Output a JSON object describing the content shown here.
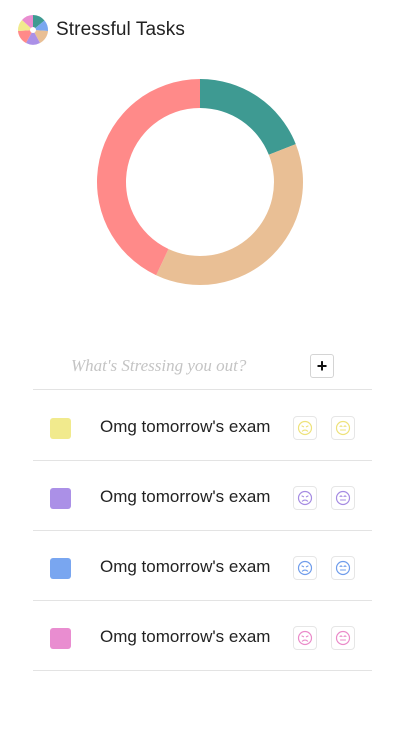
{
  "app": {
    "title": "Stressful Tasks"
  },
  "chart_data": {
    "type": "pie",
    "title": "",
    "donut": true,
    "slices": [
      {
        "value": 19,
        "color": "#3e9a92"
      },
      {
        "value": 38,
        "color": "#e9bf95"
      },
      {
        "value": 43,
        "color": "#ff8a89"
      }
    ]
  },
  "entry": {
    "placeholder": "What's Stressing you out?",
    "add_label": "+"
  },
  "tasks": [
    {
      "label": "Omg tomorrow's exam",
      "color": "#f1ea8d",
      "icon_color": "#eee27a"
    },
    {
      "label": "Omg tomorrow's exam",
      "color": "#ab90e7",
      "icon_color": "#a58be2"
    },
    {
      "label": "Omg tomorrow's exam",
      "color": "#79a6f0",
      "icon_color": "#6f9ceb"
    },
    {
      "label": "Omg tomorrow's exam",
      "color": "#e98dd0",
      "icon_color": "#ea8ac9"
    }
  ],
  "icons": {
    "logo": "pinwheel-logo-icon",
    "sad": "sad-face-icon",
    "ok": "neutral-face-icon"
  }
}
